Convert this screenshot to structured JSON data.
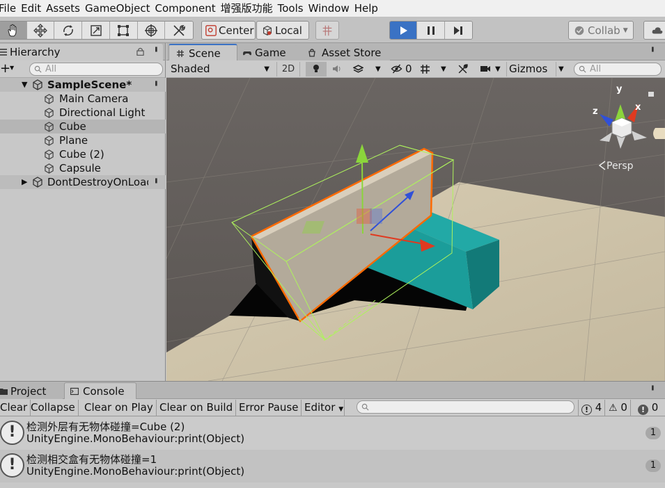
{
  "menubar": {
    "items": [
      "File",
      "Edit",
      "Assets",
      "GameObject",
      "Component",
      "增强版功能",
      "Tools",
      "Window",
      "Help"
    ]
  },
  "toolbar": {
    "tools": [
      "hand-tool",
      "move-tool",
      "rotate-tool",
      "scale-tool",
      "rect-tool",
      "transform-tool",
      "custom-tool"
    ],
    "pivot_label": "Center",
    "space_label": "Local",
    "collab_label": "Collab"
  },
  "hierarchy": {
    "tab_label": "Hierarchy",
    "search_placeholder": "All",
    "scene_name": "SampleScene*",
    "items": [
      "Main Camera",
      "Directional Light",
      "Cube",
      "Plane",
      "Cube (2)",
      "Capsule"
    ],
    "selected_index": 2,
    "ddol_name": "DontDestroyOnLoad"
  },
  "scene": {
    "tabs": [
      "Scene",
      "Game",
      "Asset Store"
    ],
    "active_tab": "Scene",
    "shading_mode": "Shaded",
    "mode_2d_label": "2D",
    "hidden_count": "0",
    "gizmos_label": "Gizmos",
    "search_placeholder": "All",
    "projection_label": "Persp",
    "axis_labels": {
      "x": "x",
      "y": "y",
      "z": "z"
    }
  },
  "bottom": {
    "tabs": [
      "Project",
      "Console"
    ],
    "active_tab": "Console"
  },
  "console": {
    "buttons": [
      "Clear",
      "Collapse",
      "Clear on Play",
      "Clear on Build",
      "Error Pause"
    ],
    "editor_label": "Editor",
    "log_count": "4",
    "warn_count": "0",
    "error_count": "0",
    "messages": [
      {
        "line1": "检测外层有无物体碰撞=Cube (2)",
        "line2": "UnityEngine.MonoBehaviour:print(Object)",
        "count": "1"
      },
      {
        "line1": "检测相交盒有无物体碰撞=1",
        "line2": "UnityEngine.MonoBehaviour:print(Object)",
        "count": "1"
      }
    ]
  },
  "colors": {
    "accent_blue": "#3a72c4",
    "selection_orange": "#ff6a00",
    "cube_teal": "#1b9d9a",
    "ground": "#c9bea5",
    "sky": "#5c5754"
  }
}
